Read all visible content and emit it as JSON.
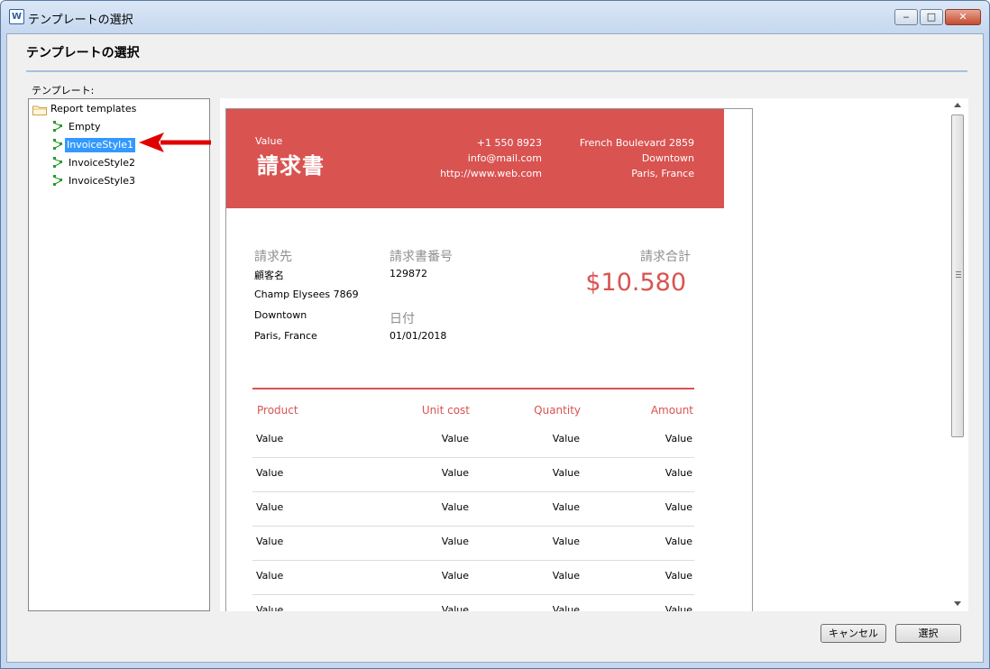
{
  "window": {
    "title": "テンプレートの選択",
    "icon": "app-icon",
    "minimize_label": "‒",
    "maximize_label": "□",
    "close_label": "✕"
  },
  "header": {
    "title": "テンプレートの選択"
  },
  "template_label": "テンプレート:",
  "tree": {
    "root": "Report templates",
    "items": [
      {
        "label": "Empty"
      },
      {
        "label": "InvoiceStyle1",
        "selected": true
      },
      {
        "label": "InvoiceStyle2"
      },
      {
        "label": "InvoiceStyle3"
      }
    ]
  },
  "preview": {
    "banner_color": "#d95351",
    "value_label": "Value",
    "doc_title": "請求書",
    "contact": [
      "+1 550 8923",
      "info@mail.com",
      "http://www.web.com"
    ],
    "address": [
      "French Boulevard 2859",
      "Downtown",
      "Paris, France"
    ],
    "bill_to": {
      "heading": "請求先",
      "lines": [
        "顧客名",
        "Champ Elysees 7869",
        "Downtown",
        "Paris, France"
      ]
    },
    "invoice_no": {
      "heading": "請求書番号",
      "value": "129872"
    },
    "date": {
      "heading": "日付",
      "value": "01/01/2018"
    },
    "total": {
      "heading": "請求合計",
      "value": "$10.580"
    },
    "table": {
      "headers": [
        "Product",
        "Unit cost",
        "Quantity",
        "Amount"
      ],
      "rows": [
        [
          "Value",
          "Value",
          "Value",
          "Value"
        ],
        [
          "Value",
          "Value",
          "Value",
          "Value"
        ],
        [
          "Value",
          "Value",
          "Value",
          "Value"
        ],
        [
          "Value",
          "Value",
          "Value",
          "Value"
        ],
        [
          "Value",
          "Value",
          "Value",
          "Value"
        ],
        [
          "Value",
          "Value",
          "Value",
          "Value"
        ]
      ]
    }
  },
  "buttons": {
    "cancel": "キャンセル",
    "select": "選択"
  }
}
